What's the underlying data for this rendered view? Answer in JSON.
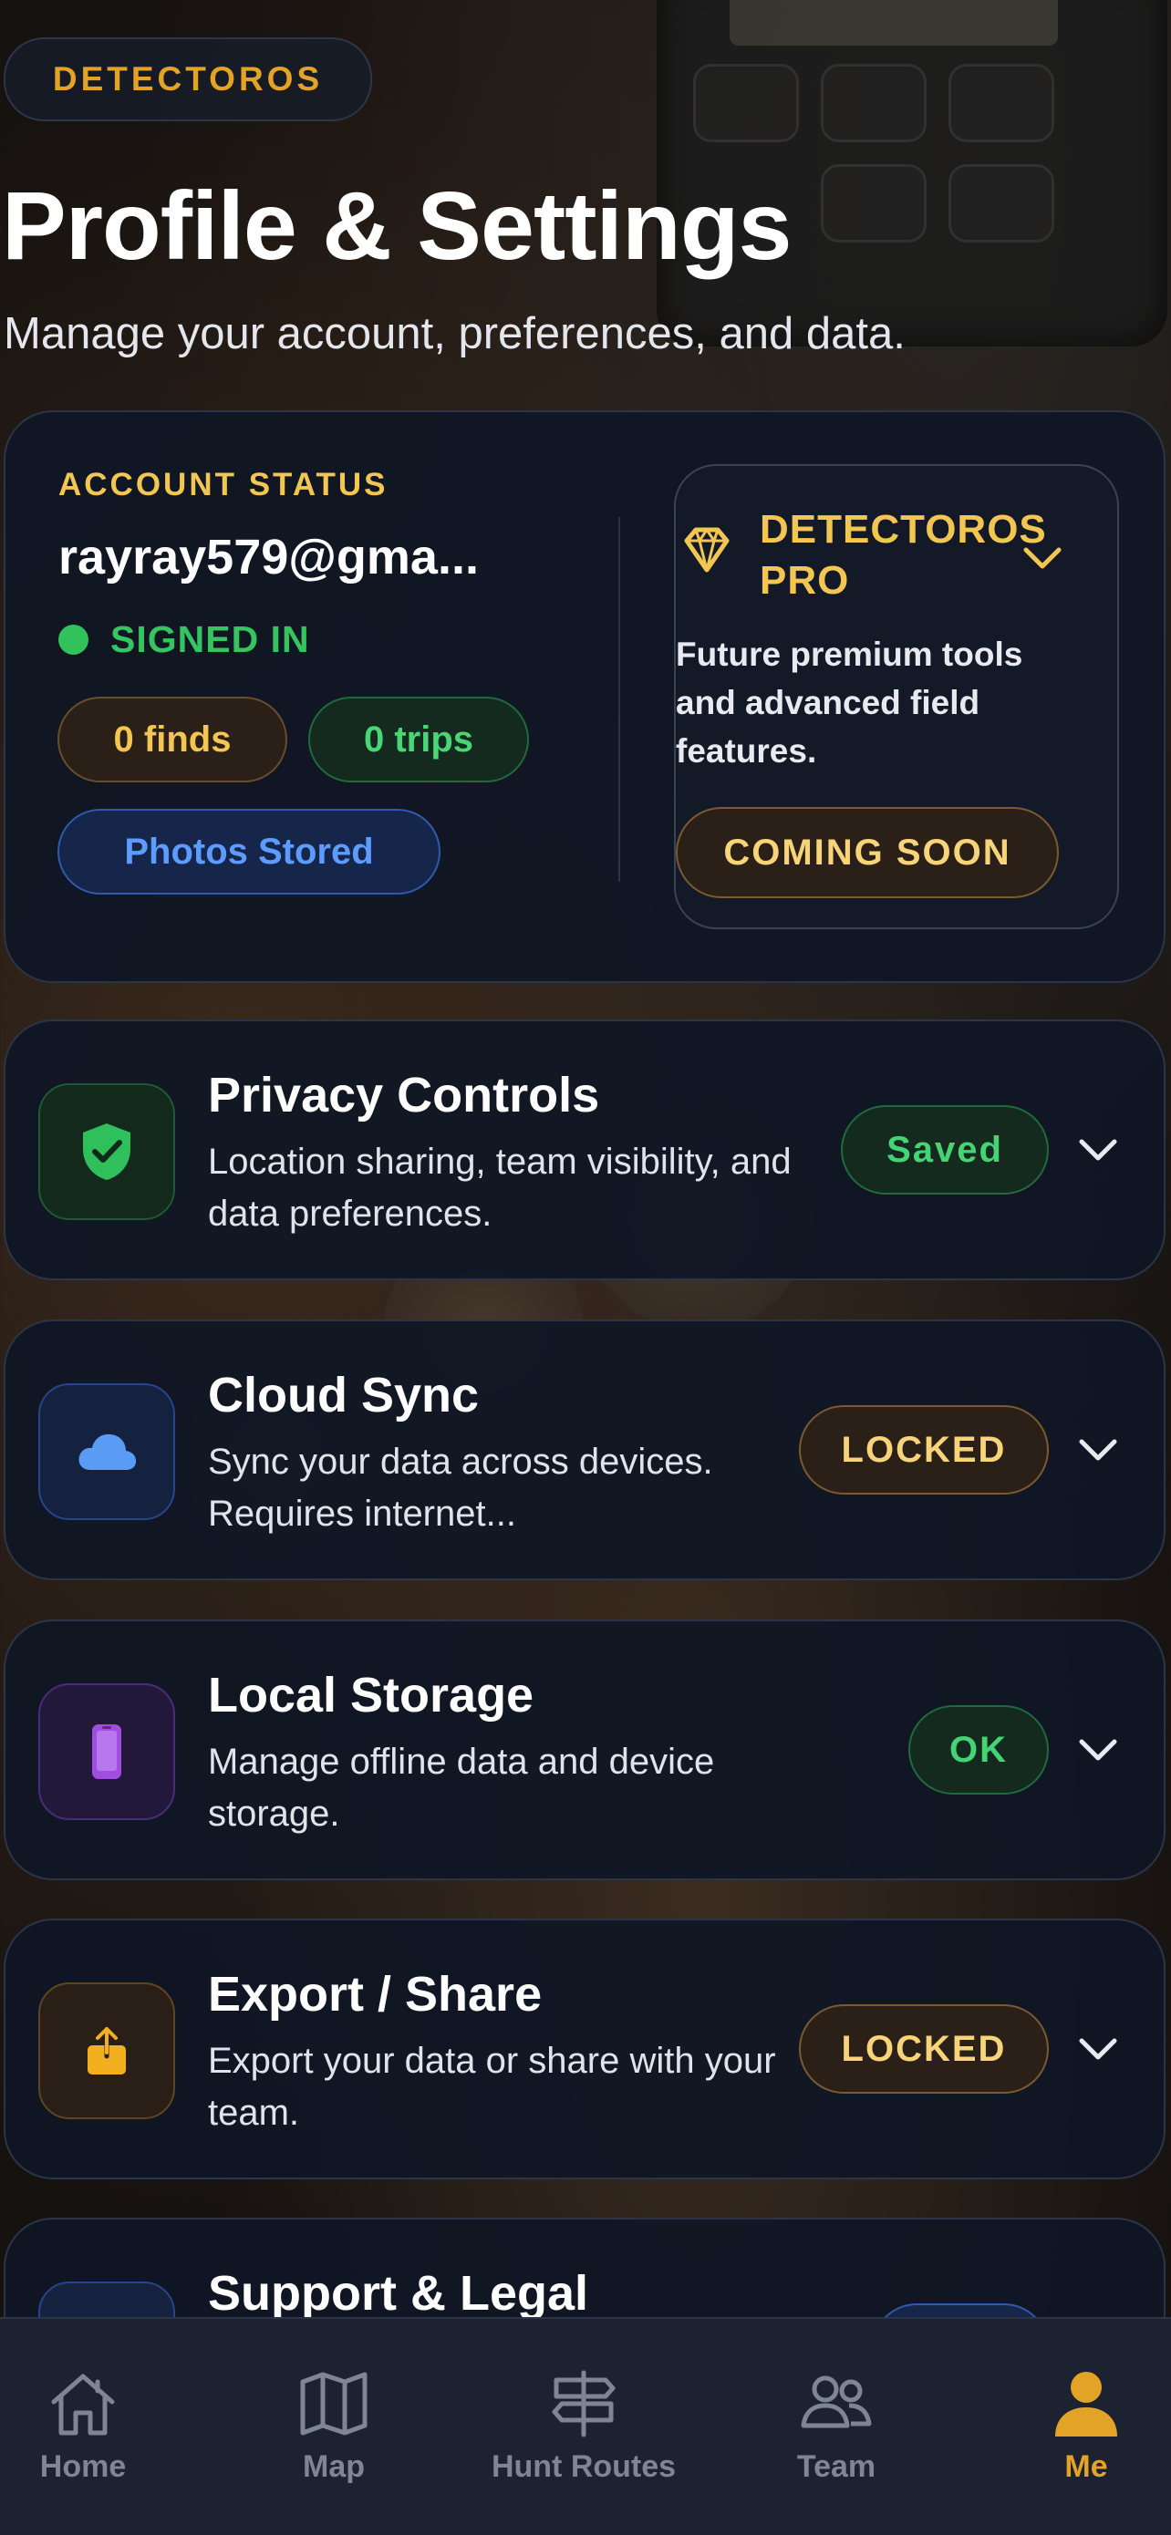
{
  "brand": "DETECTOROS",
  "page": {
    "title": "Profile & Settings",
    "subtitle": "Manage your account, preferences, and data."
  },
  "account": {
    "label": "ACCOUNT STATUS",
    "email": "rayray579@gma...",
    "status": "SIGNED IN",
    "finds": "0 finds",
    "trips": "0 trips",
    "photos": "Photos Stored"
  },
  "pro": {
    "title": "DETECTOROS PRO",
    "description": "Future premium tools and advanced field features.",
    "button": "COMING SOON"
  },
  "sections": [
    {
      "title": "Privacy Controls",
      "description": "Location sharing, team visibility, and data preferences.",
      "badge": "Saved",
      "icon": "shield-check-icon",
      "accent": "#2fbf5b"
    },
    {
      "title": "Cloud Sync",
      "description": "Sync your data across devices. Requires internet...",
      "badge": "LOCKED",
      "icon": "cloud-icon",
      "accent": "#4d8ff2"
    },
    {
      "title": "Local Storage",
      "description": "Manage offline data and device storage.",
      "badge": "OK",
      "icon": "phone-icon",
      "accent": "#a04ee0"
    },
    {
      "title": "Export / Share",
      "description": "Export your data or share with your team.",
      "badge": "LOCKED",
      "icon": "share-upload-icon",
      "accent": "#f2b01e"
    },
    {
      "title": "Support & Legal",
      "icon": "support-icon"
    }
  ],
  "tabs": [
    {
      "label": "Home",
      "icon": "home-icon"
    },
    {
      "label": "Map",
      "icon": "map-icon"
    },
    {
      "label": "Hunt Routes",
      "icon": "signpost-icon"
    },
    {
      "label": "Team",
      "icon": "team-icon"
    },
    {
      "label": "Me",
      "icon": "person-icon",
      "active": true
    }
  ]
}
